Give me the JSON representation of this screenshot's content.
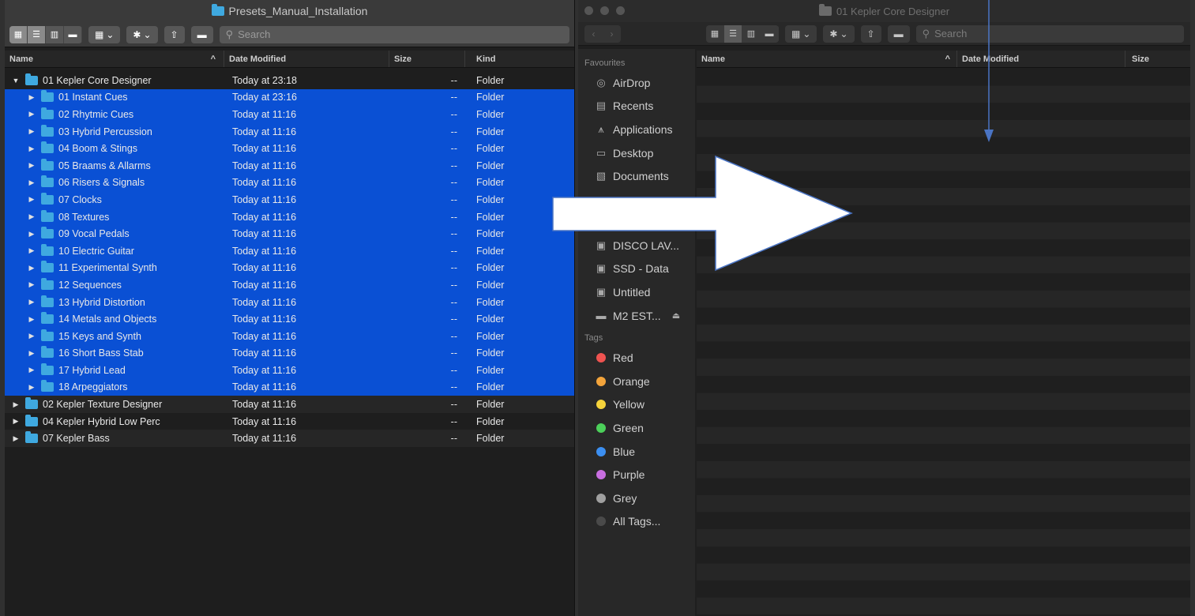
{
  "left_window": {
    "title": "Presets_Manual_Installation",
    "search_placeholder": "Search",
    "columns": {
      "name": "Name",
      "date": "Date Modified",
      "size": "Size",
      "kind": "Kind"
    },
    "rows": [
      {
        "name": "01 Kepler Core Designer",
        "date": "Today at 23:18",
        "size": "--",
        "kind": "Folder"
      },
      {
        "name": "01 Instant Cues",
        "date": "Today at 23:16",
        "size": "--",
        "kind": "Folder"
      },
      {
        "name": "02 Rhytmic Cues",
        "date": "Today at 11:16",
        "size": "--",
        "kind": "Folder"
      },
      {
        "name": "03 Hybrid Percussion",
        "date": "Today at 11:16",
        "size": "--",
        "kind": "Folder"
      },
      {
        "name": "04 Boom & Stings",
        "date": "Today at 11:16",
        "size": "--",
        "kind": "Folder"
      },
      {
        "name": "05 Braams & Allarms",
        "date": "Today at 11:16",
        "size": "--",
        "kind": "Folder"
      },
      {
        "name": "06 Risers & Signals",
        "date": "Today at 11:16",
        "size": "--",
        "kind": "Folder"
      },
      {
        "name": "07 Clocks",
        "date": "Today at 11:16",
        "size": "--",
        "kind": "Folder"
      },
      {
        "name": "08 Textures",
        "date": "Today at 11:16",
        "size": "--",
        "kind": "Folder"
      },
      {
        "name": "09 Vocal Pedals",
        "date": "Today at 11:16",
        "size": "--",
        "kind": "Folder"
      },
      {
        "name": "10 Electric Guitar",
        "date": "Today at 11:16",
        "size": "--",
        "kind": "Folder"
      },
      {
        "name": "11 Experimental Synth",
        "date": "Today at 11:16",
        "size": "--",
        "kind": "Folder"
      },
      {
        "name": "12 Sequences",
        "date": "Today at 11:16",
        "size": "--",
        "kind": "Folder"
      },
      {
        "name": "13 Hybrid Distortion",
        "date": "Today at 11:16",
        "size": "--",
        "kind": "Folder"
      },
      {
        "name": "14 Metals and Objects",
        "date": "Today at 11:16",
        "size": "--",
        "kind": "Folder"
      },
      {
        "name": "15 Keys and Synth",
        "date": "Today at 11:16",
        "size": "--",
        "kind": "Folder"
      },
      {
        "name": "16 Short Bass Stab",
        "date": "Today at 11:16",
        "size": "--",
        "kind": "Folder"
      },
      {
        "name": "17 Hybrid Lead",
        "date": "Today at 11:16",
        "size": "--",
        "kind": "Folder"
      },
      {
        "name": "18 Arpeggiators",
        "date": "Today at 11:16",
        "size": "--",
        "kind": "Folder"
      },
      {
        "name": "02 Kepler Texture Designer",
        "date": "Today at 11:16",
        "size": "--",
        "kind": "Folder"
      },
      {
        "name": "04 Kepler Hybrid Low Perc",
        "date": "Today at 11:16",
        "size": "--",
        "kind": "Folder"
      },
      {
        "name": "07 Kepler Bass",
        "date": "Today at 11:16",
        "size": "--",
        "kind": "Folder"
      }
    ]
  },
  "right_window": {
    "title": "01 Kepler Core Designer",
    "search_placeholder": "Search",
    "columns": {
      "name": "Name",
      "date": "Date Modified",
      "size": "Size"
    },
    "sidebar": {
      "favourites_label": "Favourites",
      "favourites": [
        {
          "label": "AirDrop",
          "icon": "airdrop-icon"
        },
        {
          "label": "Recents",
          "icon": "recents-icon"
        },
        {
          "label": "Applications",
          "icon": "applications-icon"
        },
        {
          "label": "Desktop",
          "icon": "desktop-icon"
        },
        {
          "label": "Documents",
          "icon": "documents-icon"
        }
      ],
      "locations": [
        {
          "label": "DISCO LAV...",
          "icon": "disk-icon"
        },
        {
          "label": "SSD - Data",
          "icon": "disk-icon"
        },
        {
          "label": "Untitled",
          "icon": "disk-icon"
        },
        {
          "label": "M2 EST...",
          "icon": "external-drive-icon",
          "eject": "⏏"
        }
      ],
      "tags_label": "Tags",
      "tags": [
        {
          "label": "Red",
          "color": "#ef5350"
        },
        {
          "label": "Orange",
          "color": "#f3a43b"
        },
        {
          "label": "Yellow",
          "color": "#f5d33b"
        },
        {
          "label": "Green",
          "color": "#4cd05a"
        },
        {
          "label": "Blue",
          "color": "#3c8ff1"
        },
        {
          "label": "Purple",
          "color": "#c86ee0"
        },
        {
          "label": "Grey",
          "color": "#a0a0a0"
        },
        {
          "label": "All Tags...",
          "color": "#4a4a4a"
        }
      ]
    }
  },
  "colors": {
    "selection": "#0a50d4",
    "folder": "#3fa9e0",
    "arrow": "#4a74c4"
  }
}
